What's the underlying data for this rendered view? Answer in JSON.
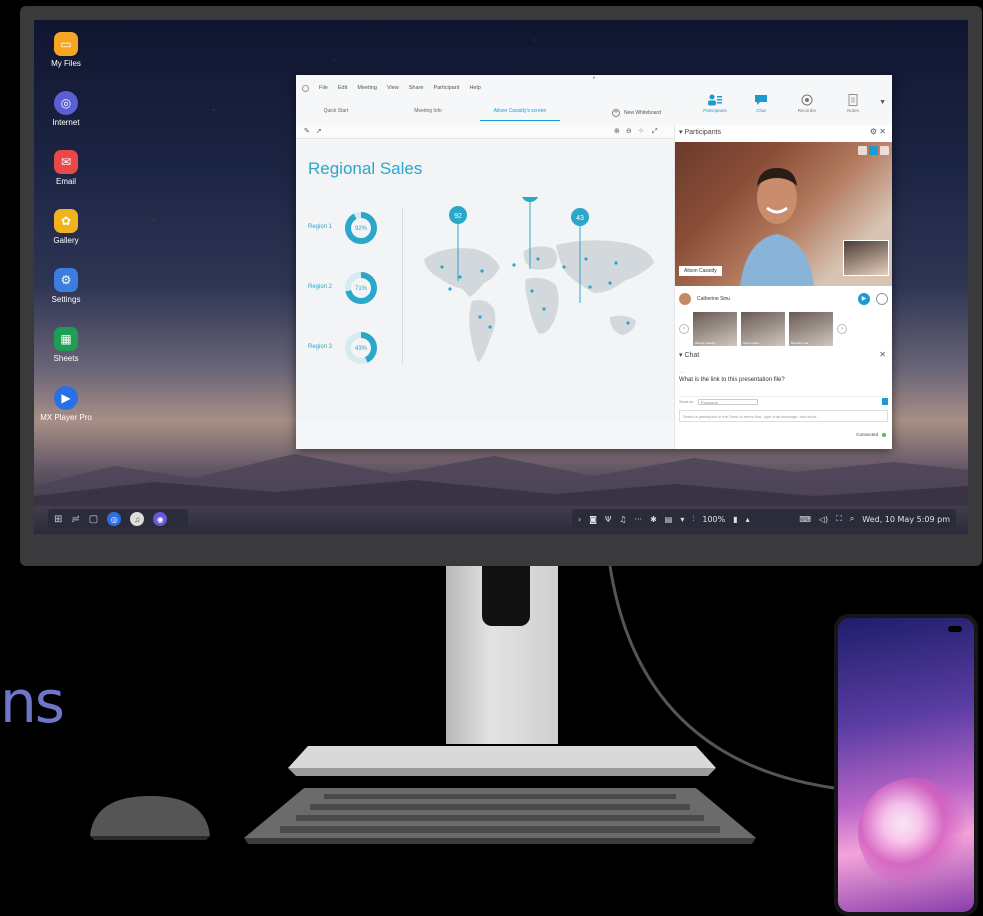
{
  "background": {
    "partial_word": "ns"
  },
  "desktop": {
    "icons": [
      {
        "label": "My Files",
        "icon": "folder-icon",
        "color": "#f5a623"
      },
      {
        "label": "Internet",
        "icon": "internet-icon",
        "color": "#5b5fd4"
      },
      {
        "label": "Email",
        "icon": "email-icon",
        "color": "#e94848"
      },
      {
        "label": "Gallery",
        "icon": "gallery-icon",
        "color": "#f0b21e"
      },
      {
        "label": "Settings",
        "icon": "settings-icon",
        "color": "#3d7de0"
      },
      {
        "label": "Sheets",
        "icon": "sheets-icon",
        "color": "#1f9d55"
      },
      {
        "label": "MX Player Pro",
        "icon": "play-icon",
        "color": "#2b6fe8"
      }
    ]
  },
  "taskbar": {
    "battery": "100%",
    "datetime": "Wed, 10 May  5:09 pm"
  },
  "app": {
    "menu": [
      "File",
      "Edit",
      "Meeting",
      "View",
      "Share",
      "Participant",
      "Help"
    ],
    "tabs": [
      "Quick Start",
      "Meeting Info",
      "Alison Cassidy's screen"
    ],
    "active_tab_index": 2,
    "new_whiteboard": "New Whiteboard",
    "right_tools": [
      "Participants",
      "Chat",
      "Recorder",
      "Notes"
    ],
    "slide": {
      "title": "Regional Sales",
      "regions": [
        {
          "label": "Region 1",
          "percent": "92%",
          "value": 0.92
        },
        {
          "label": "Region 2",
          "percent": "71%",
          "value": 0.71
        },
        {
          "label": "Region 3",
          "percent": "43%",
          "value": 0.43
        }
      ],
      "pins": [
        "92",
        "71",
        "43"
      ]
    },
    "panel": {
      "participants_header": "Participants",
      "video_name": "Alison Cassidy",
      "speaker_name": "Catherine Sinu",
      "thumbnails": [
        "Wendy Cassidy",
        "Steve Fuller",
        "Benjamin Ha"
      ],
      "chat_header": "Chat",
      "chat_message": "What is the link to this presentation file?",
      "send_to_label": "Send to:",
      "send_to_value": "Everyone",
      "chat_placeholder": "Select a participant in the Send to menu first, type chat message, and send...",
      "connected": "Connected"
    }
  }
}
